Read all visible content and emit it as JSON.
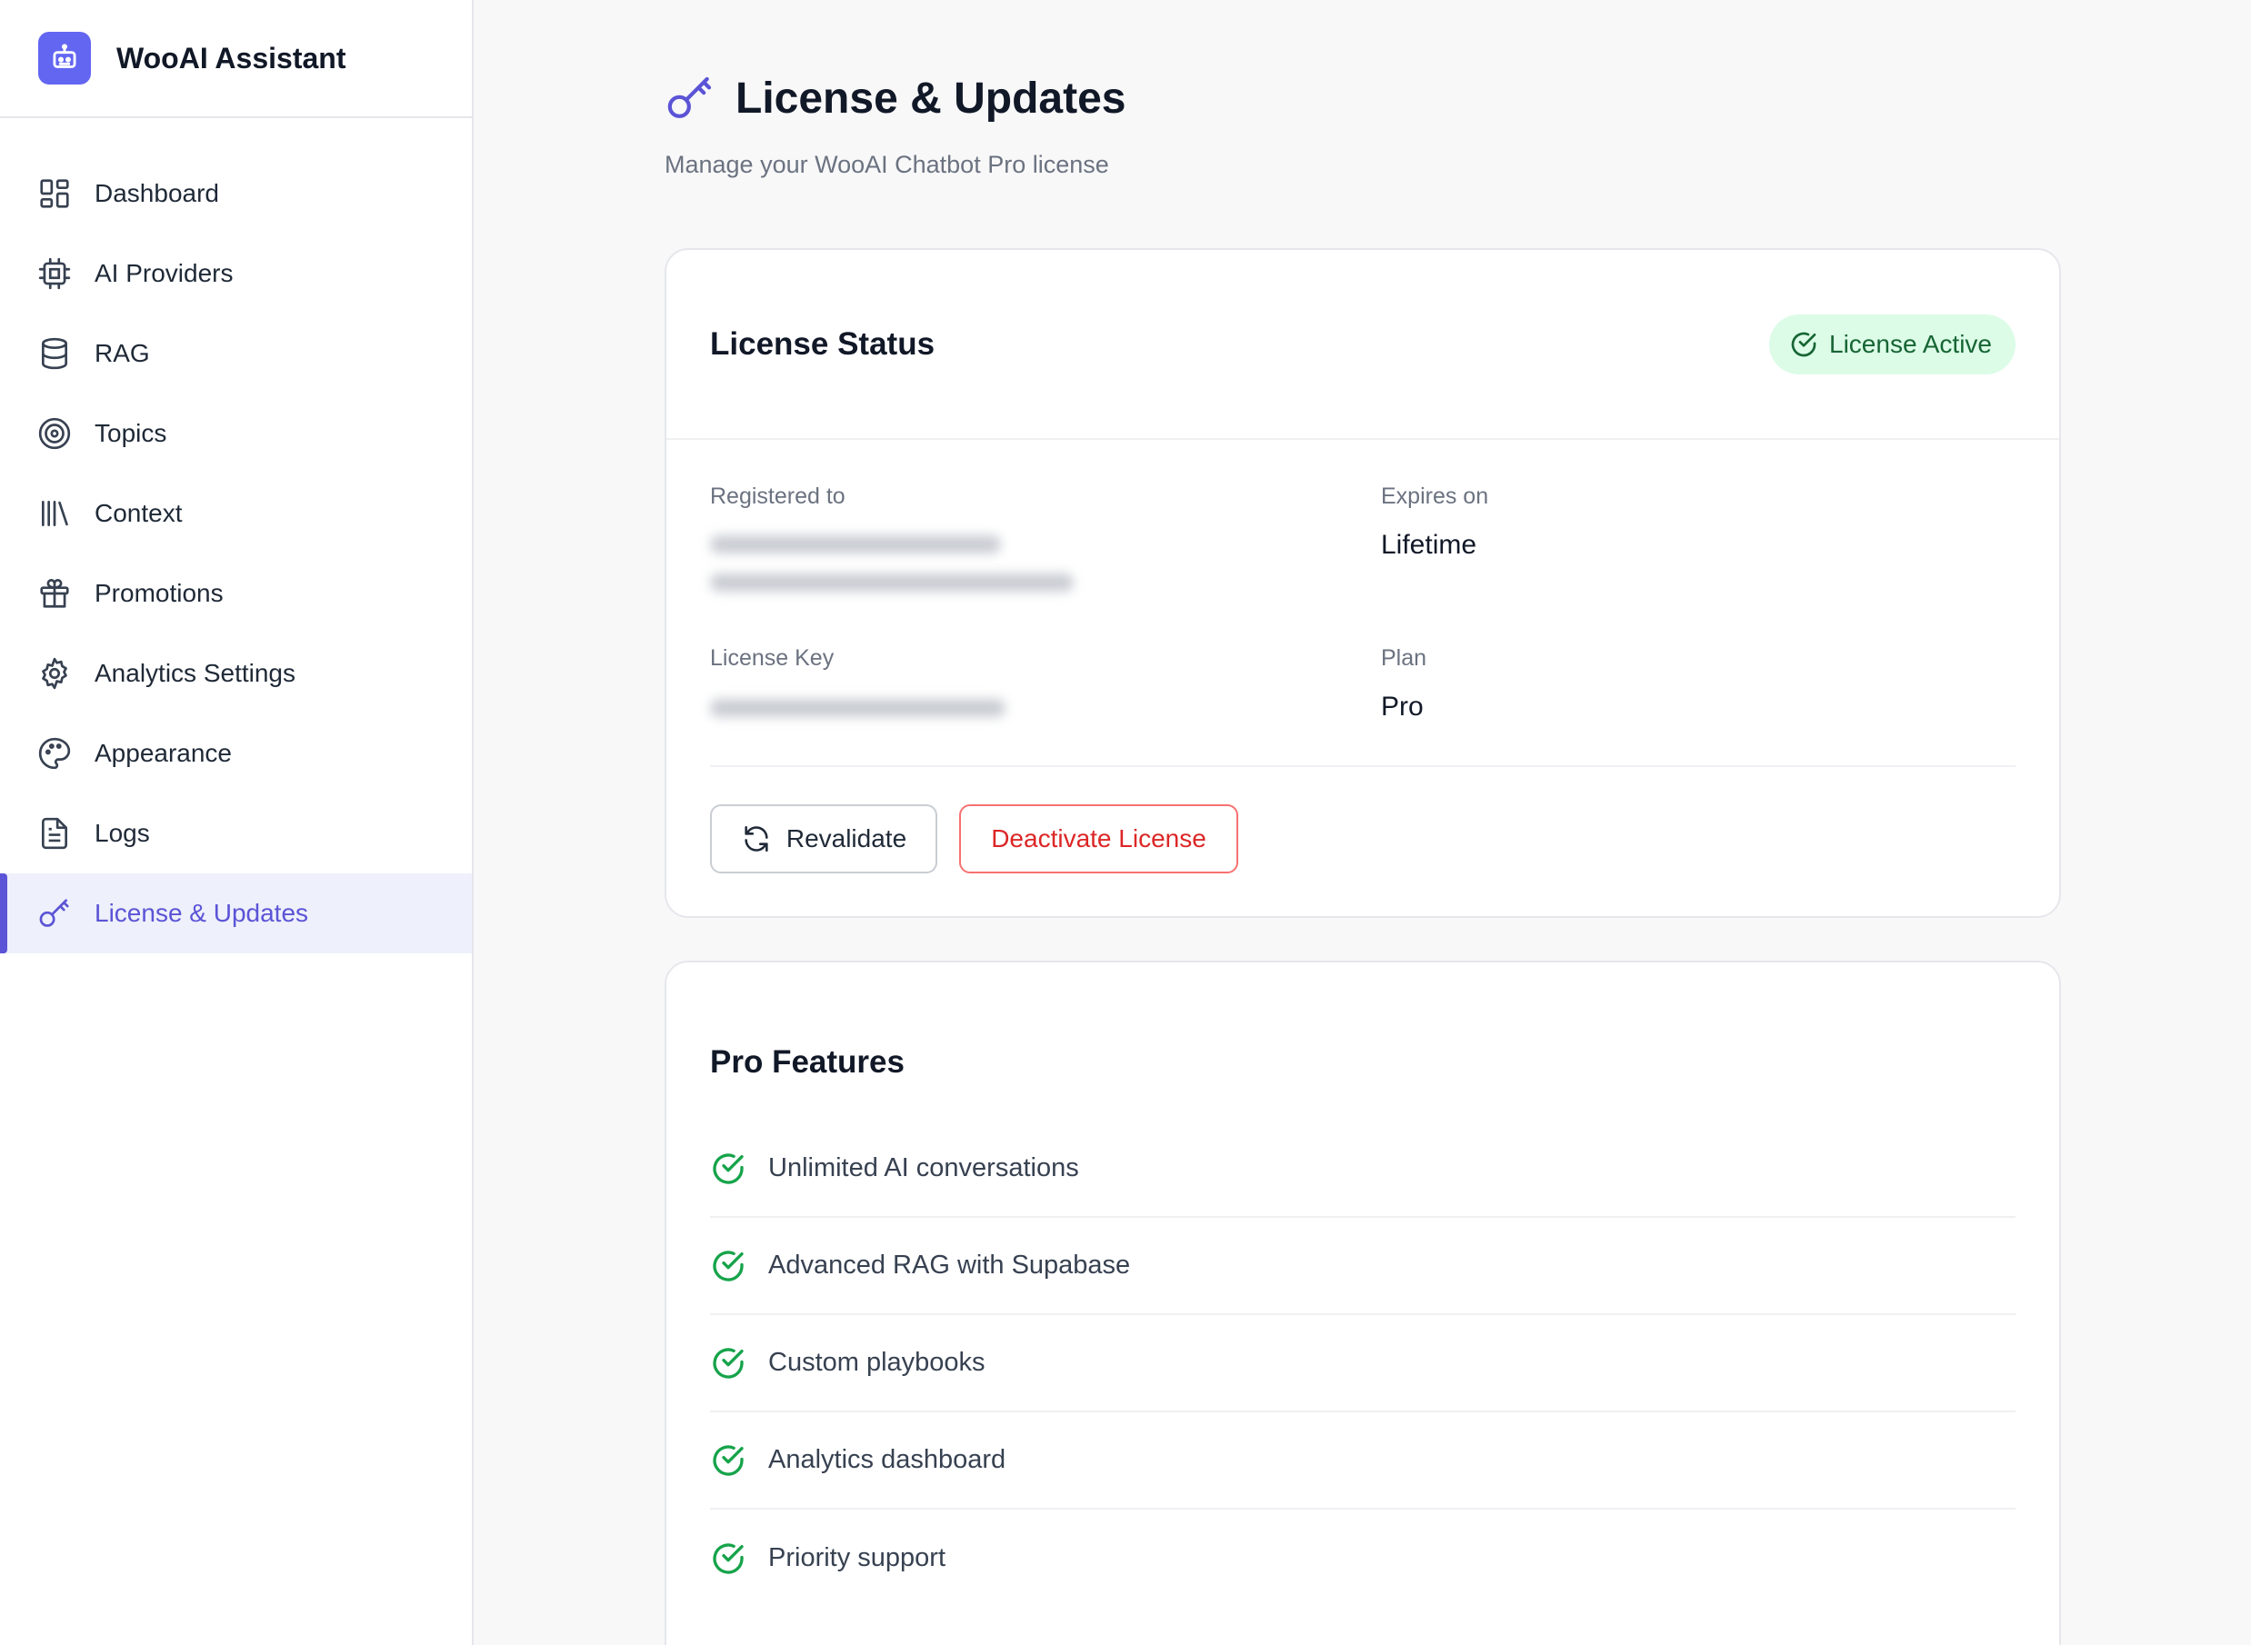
{
  "brand": {
    "title": "WooAI Assistant",
    "icon": "robot-chat-icon"
  },
  "sidebar": {
    "items": [
      {
        "label": "Dashboard",
        "icon": "dashboard-grid-icon"
      },
      {
        "label": "AI Providers",
        "icon": "cpu-chip-icon"
      },
      {
        "label": "RAG",
        "icon": "database-icon"
      },
      {
        "label": "Topics",
        "icon": "target-icon"
      },
      {
        "label": "Context",
        "icon": "library-icon"
      },
      {
        "label": "Promotions",
        "icon": "gift-icon"
      },
      {
        "label": "Analytics Settings",
        "icon": "gear-icon"
      },
      {
        "label": "Appearance",
        "icon": "palette-icon"
      },
      {
        "label": "Logs",
        "icon": "document-icon"
      },
      {
        "label": "License & Updates",
        "icon": "key-icon",
        "active": true
      }
    ]
  },
  "page": {
    "title": "License & Updates",
    "subtitle": "Manage your WooAI Chatbot Pro license"
  },
  "license": {
    "card_title": "License Status",
    "status_badge": "License Active",
    "registered_label": "Registered to",
    "expires_label": "Expires on",
    "expires_value": "Lifetime",
    "key_label": "License Key",
    "plan_label": "Plan",
    "plan_value": "Pro",
    "revalidate_label": "Revalidate",
    "deactivate_label": "Deactivate License"
  },
  "features": {
    "title": "Pro Features",
    "items": [
      "Unlimited AI conversations",
      "Advanced RAG with Supabase",
      "Custom playbooks",
      "Analytics dashboard",
      "Priority support"
    ]
  },
  "colors": {
    "accent": "#5b54d6",
    "success": "#16a34a",
    "danger": "#dc2626",
    "badge_bg": "#dcfce7"
  }
}
